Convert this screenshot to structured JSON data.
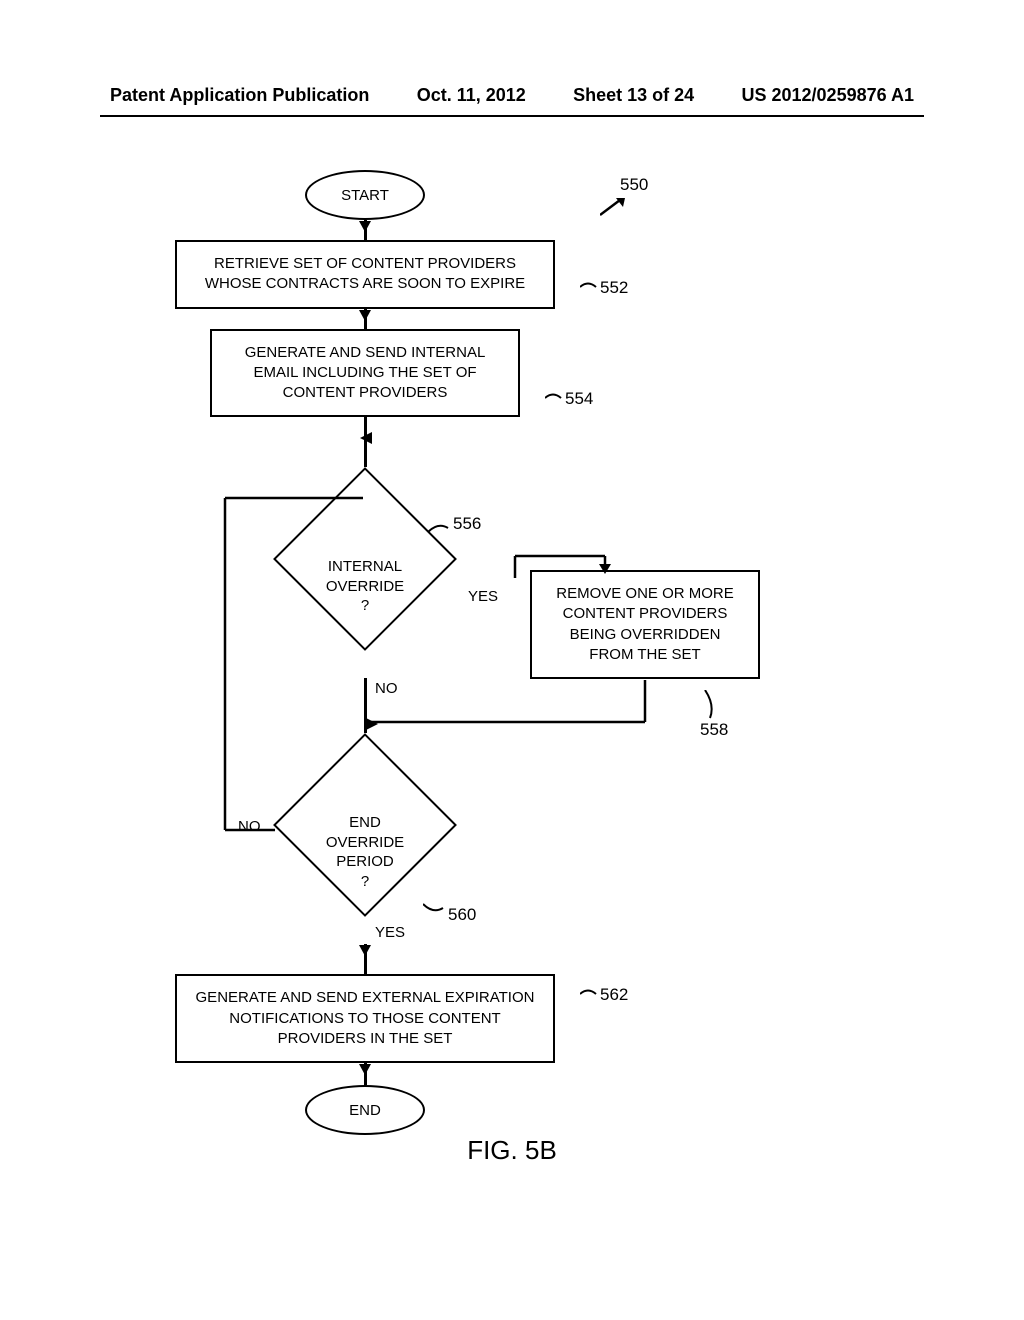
{
  "header": {
    "pub_type": "Patent Application Publication",
    "date": "Oct. 11, 2012",
    "sheet": "Sheet 13 of 24",
    "pub_num": "US 2012/0259876 A1"
  },
  "refs": {
    "top": "550",
    "r552": "552",
    "r554": "554",
    "r556": "556",
    "r558": "558",
    "r560": "560",
    "r562": "562"
  },
  "nodes": {
    "start": "START",
    "n552": "RETRIEVE SET OF CONTENT PROVIDERS WHOSE CONTRACTS ARE SOON TO EXPIRE",
    "n554": "GENERATE AND SEND INTERNAL EMAIL INCLUDING THE SET OF CONTENT PROVIDERS",
    "d556": "INTERNAL\nOVERRIDE\n?",
    "n558": "REMOVE ONE OR MORE CONTENT PROVIDERS BEING OVERRIDDEN FROM THE SET",
    "d560": "END\nOVERRIDE\nPERIOD\n?",
    "n562": "GENERATE AND SEND EXTERNAL EXPIRATION NOTIFICATIONS TO THOSE CONTENT PROVIDERS IN THE SET",
    "end": "END"
  },
  "edges": {
    "yes": "YES",
    "no": "NO"
  },
  "figure_caption": "FIG. 5B",
  "chart_data": {
    "type": "flowchart",
    "title": "FIG. 5B",
    "reference": "550",
    "nodes": [
      {
        "id": "start",
        "type": "terminator",
        "label": "START"
      },
      {
        "id": "552",
        "type": "process",
        "label": "RETRIEVE SET OF CONTENT PROVIDERS WHOSE CONTRACTS ARE SOON TO EXPIRE"
      },
      {
        "id": "554",
        "type": "process",
        "label": "GENERATE AND SEND INTERNAL EMAIL INCLUDING THE SET OF CONTENT PROVIDERS"
      },
      {
        "id": "556",
        "type": "decision",
        "label": "INTERNAL OVERRIDE ?"
      },
      {
        "id": "558",
        "type": "process",
        "label": "REMOVE ONE OR MORE CONTENT PROVIDERS BEING OVERRIDDEN FROM THE SET"
      },
      {
        "id": "560",
        "type": "decision",
        "label": "END OVERRIDE PERIOD ?"
      },
      {
        "id": "562",
        "type": "process",
        "label": "GENERATE AND SEND EXTERNAL EXPIRATION NOTIFICATIONS TO THOSE CONTENT PROVIDERS IN THE SET"
      },
      {
        "id": "end",
        "type": "terminator",
        "label": "END"
      }
    ],
    "edges": [
      {
        "from": "start",
        "to": "552"
      },
      {
        "from": "552",
        "to": "554"
      },
      {
        "from": "554",
        "to": "556"
      },
      {
        "from": "556",
        "to": "558",
        "label": "YES"
      },
      {
        "from": "556",
        "to": "560",
        "label": "NO"
      },
      {
        "from": "558",
        "to": "560"
      },
      {
        "from": "560",
        "to": "556",
        "label": "NO"
      },
      {
        "from": "560",
        "to": "562",
        "label": "YES"
      },
      {
        "from": "562",
        "to": "end"
      }
    ]
  }
}
